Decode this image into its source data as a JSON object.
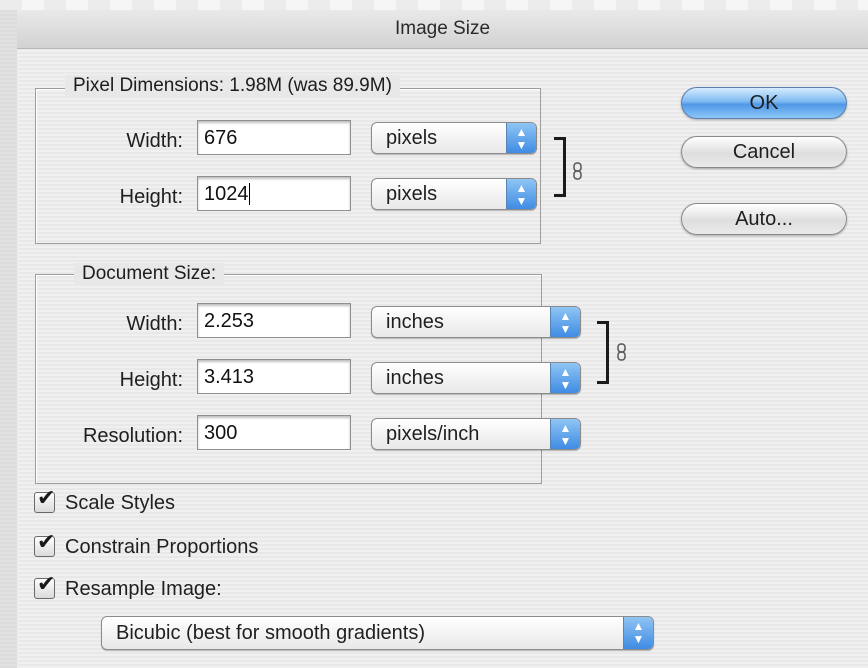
{
  "dialog": {
    "title": "Image Size"
  },
  "pixel_dimensions": {
    "legend": "Pixel Dimensions:  1.98M (was 89.9M)",
    "width_label": "Width:",
    "width_value": "676",
    "width_unit": "pixels",
    "height_label": "Height:",
    "height_value": "1024",
    "height_unit": "pixels"
  },
  "document_size": {
    "legend": "Document Size:",
    "width_label": "Width:",
    "width_value": "2.253",
    "width_unit": "inches",
    "height_label": "Height:",
    "height_value": "3.413",
    "height_unit": "inches",
    "resolution_label": "Resolution:",
    "resolution_value": "300",
    "resolution_unit": "pixels/inch"
  },
  "buttons": {
    "ok": "OK",
    "cancel": "Cancel",
    "auto": "Auto..."
  },
  "options": {
    "scale_styles": {
      "label": "Scale Styles",
      "checked": true
    },
    "constrain_proportions": {
      "label": "Constrain Proportions",
      "checked": true
    },
    "resample_image": {
      "label": "Resample Image:",
      "checked": true
    },
    "resample_method": "Bicubic (best for smooth gradients)"
  },
  "icons": {
    "link_icon": "chain-link-icon",
    "stepper_icon": "up-down-arrows-icon",
    "checkmark_icon": "checkmark-icon"
  },
  "colors": {
    "accent": "#4f97e6",
    "dialog_bg": "#e8e8e8",
    "group_border": "#9d9d9d"
  }
}
